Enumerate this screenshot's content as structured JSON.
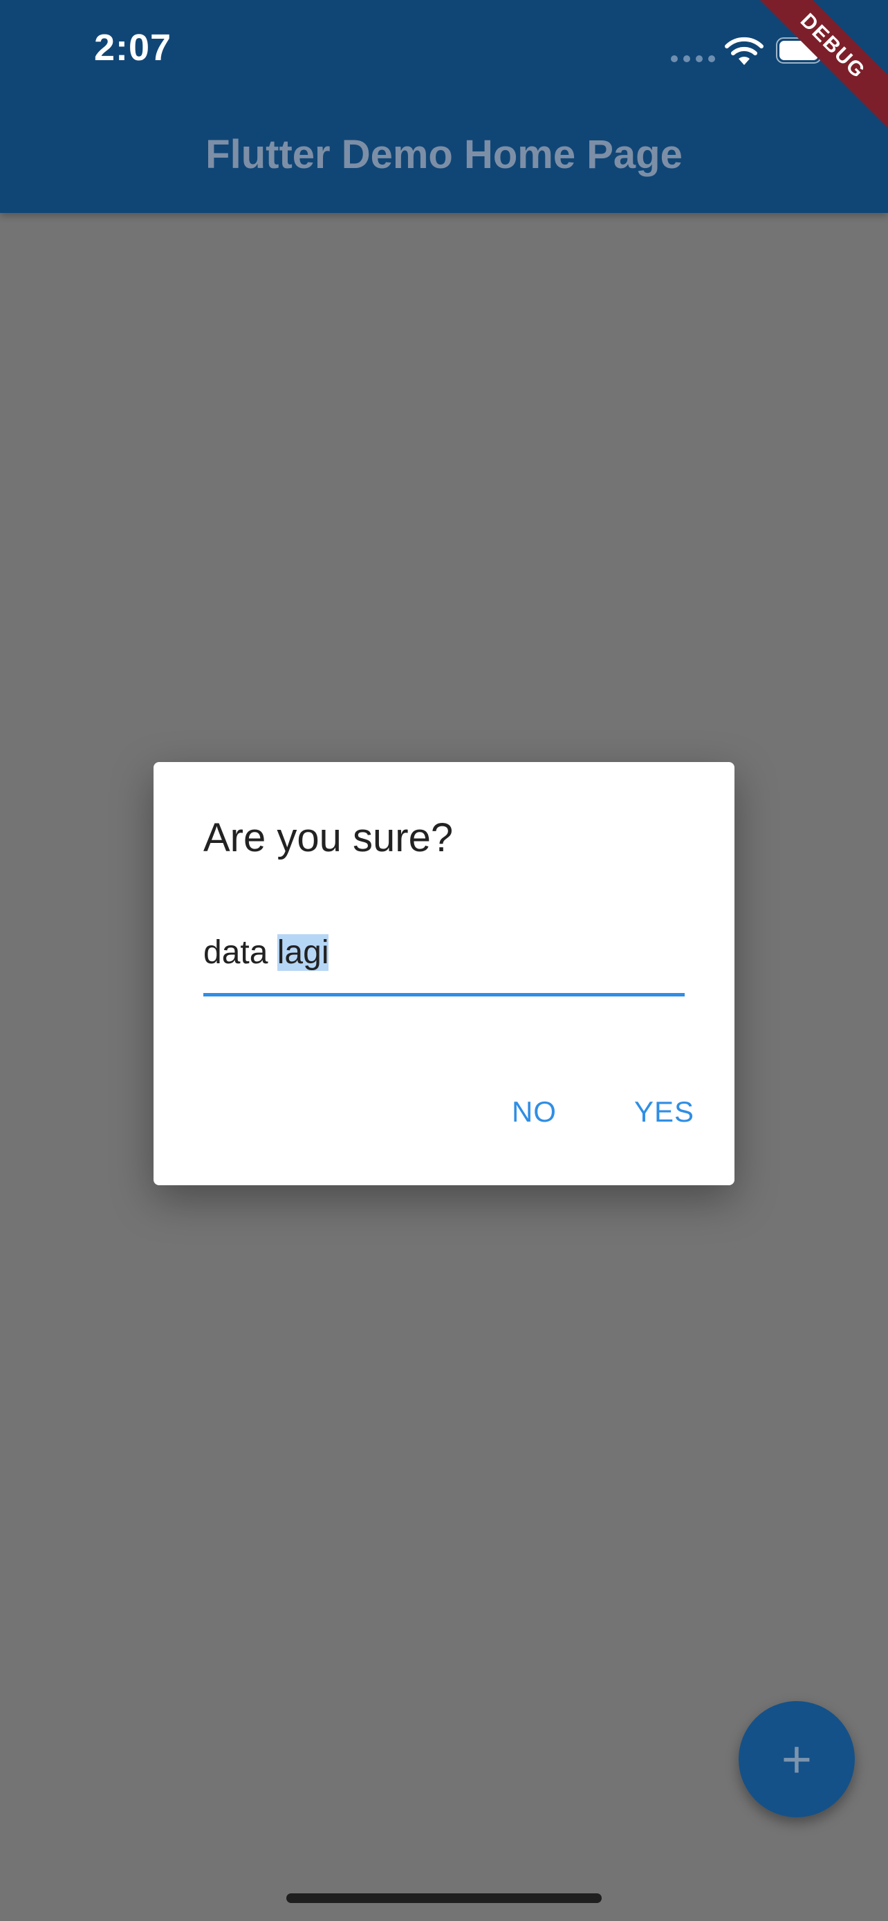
{
  "status_bar": {
    "time": "2:07"
  },
  "app_bar": {
    "title": "Flutter Demo Home Page",
    "debug_label": "DEBUG"
  },
  "dialog": {
    "title": "Are you sure?",
    "input": {
      "value_unselected": "data ",
      "value_selected": "lagi"
    },
    "buttons": {
      "no": "NO",
      "yes": "YES"
    }
  },
  "fab": {
    "icon": "plus-icon",
    "label": "+"
  },
  "colors": {
    "app_bar": "#104676",
    "scrim": "#747474",
    "accent": "#2f8ee4",
    "debug_banner": "#7d1f2a"
  }
}
